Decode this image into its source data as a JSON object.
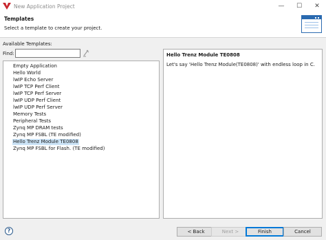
{
  "window": {
    "title": "New Application Project"
  },
  "header": {
    "title": "Templates",
    "description": "Select a template to create your project."
  },
  "available_templates_label": "Available Templates:",
  "find": {
    "label": "Find:",
    "value": ""
  },
  "templates": [
    "Empty Application",
    "Hello World",
    "lwIP Echo Server",
    "lwIP TCP Perf Client",
    "lwIP TCP Perf Server",
    "lwIP UDP Perf Client",
    "lwIP UDP Perf Server",
    "Memory Tests",
    "Peripheral Tests",
    "Zynq MP DRAM tests",
    "Zynq MP FSBL (TE modified)",
    "Hello Trenz Module TE0808",
    "Zynq MP FSBL for Flash. (TE modified)"
  ],
  "selected_index": 11,
  "description_panel": {
    "title": "Hello Trenz Module TE0808",
    "text": "Let's say 'Hello Trenz Module(TE0808)'  with endless loop in C."
  },
  "buttons": {
    "help": "?",
    "back": "< Back",
    "next": "Next >",
    "finish": "Finish",
    "cancel": "Cancel"
  },
  "colors": {
    "selection": "#cce4f7",
    "accent": "#0078d7",
    "logo": "#c9272f"
  }
}
